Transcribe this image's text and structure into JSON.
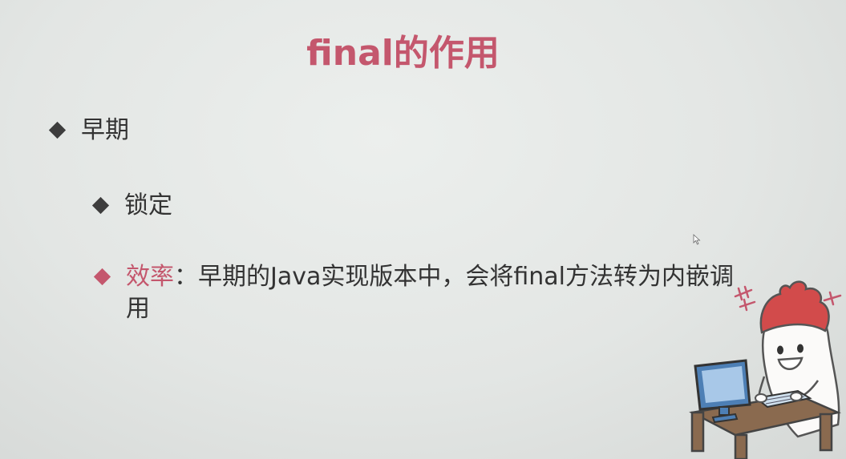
{
  "title": "final的作用",
  "bullets": [
    {
      "label": "早期"
    },
    {
      "label": "锁定"
    },
    {
      "highlight": "效率",
      "separator": "：",
      "text": "早期的Java实现版本中，会将final方法转为内嵌调",
      "text_line2": "用"
    }
  ],
  "colors": {
    "accent": "#c4576d",
    "text": "#333333",
    "background": "#e6e9e7"
  },
  "icons": [
    "diamond-bullet-icon",
    "mouse-cursor-icon",
    "mascot-illustration"
  ]
}
